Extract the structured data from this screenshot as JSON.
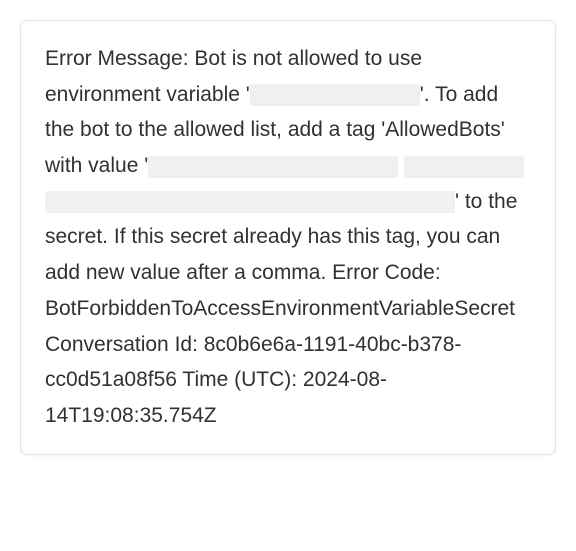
{
  "error": {
    "prefix": "Error Message: Bot is not allowed to use environment variable '",
    "after_var": "'. To add the bot to the allowed list, add a tag 'AllowedBots' with value '",
    "after_value": "' to the secret. If this secret already has this tag, you can add new value after a comma. Error Code: BotForbiddenToAccessEnvironmentVariableSecret Conversation Id: 8c0b6e6a-1191-40bc-b378-cc0d51a08f56 Time (UTC): 2024-08-14T19:08:35.754Z",
    "error_code": "BotForbiddenToAccessEnvironmentVariableSecret",
    "conversation_id": "8c0b6e6a-1191-40bc-b378-cc0d51a08f56",
    "time_utc": "2024-08-14T19:08:35.754Z"
  }
}
